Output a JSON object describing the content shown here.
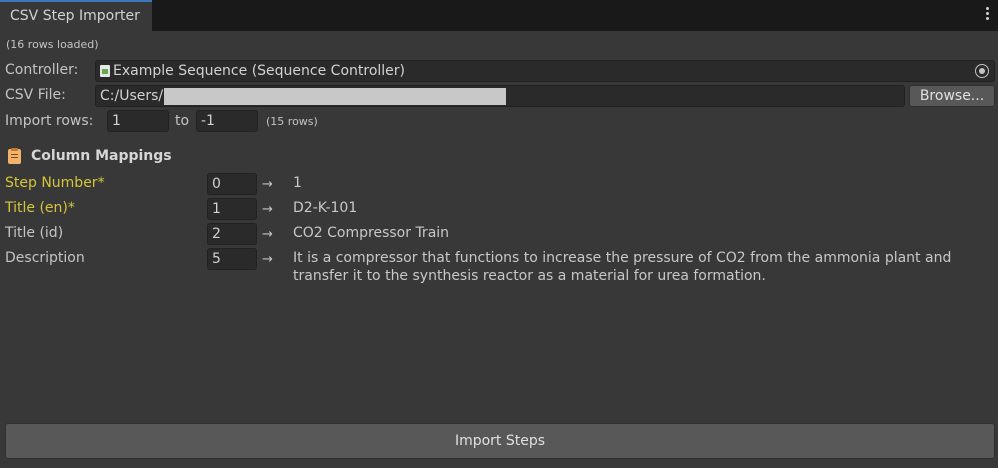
{
  "window": {
    "tab_title": "CSV Step Importer"
  },
  "status": "(16 rows loaded)",
  "controller": {
    "label": "Controller:",
    "value": "Example Sequence (Sequence Controller)"
  },
  "csv_file": {
    "label": "CSV File:",
    "value": "C:/Users/",
    "browse_label": "Browse..."
  },
  "import_rows": {
    "label": "Import rows:",
    "from": "1",
    "to_label": "to",
    "to": "-1",
    "count": "(15 rows)"
  },
  "mappings": {
    "title": "Column Mappings",
    "arrow": "→",
    "rows": [
      {
        "label": "Step Number*",
        "index": "0",
        "value": "1",
        "required": true
      },
      {
        "label": "Title (en)*",
        "index": "1",
        "value": "D2-K-101",
        "required": true
      },
      {
        "label": "Title (id)",
        "index": "2",
        "value": "CO2 Compressor Train",
        "required": false
      },
      {
        "label": "Description",
        "index": "5",
        "value": "It is a compressor that functions to increase the pressure of CO2 from the ammonia plant and transfer it to the synthesis reactor as a material for urea formation.",
        "required": false
      }
    ]
  },
  "import_button": "Import Steps",
  "colors": {
    "required": "#d6c53a",
    "tab_accent": "#3a79bb",
    "background": "#383838"
  },
  "icons": {
    "controller": "scriptable-object-icon",
    "picker": "object-picker-icon",
    "section": "clipboard-icon",
    "menu": "kebab-menu-icon"
  }
}
